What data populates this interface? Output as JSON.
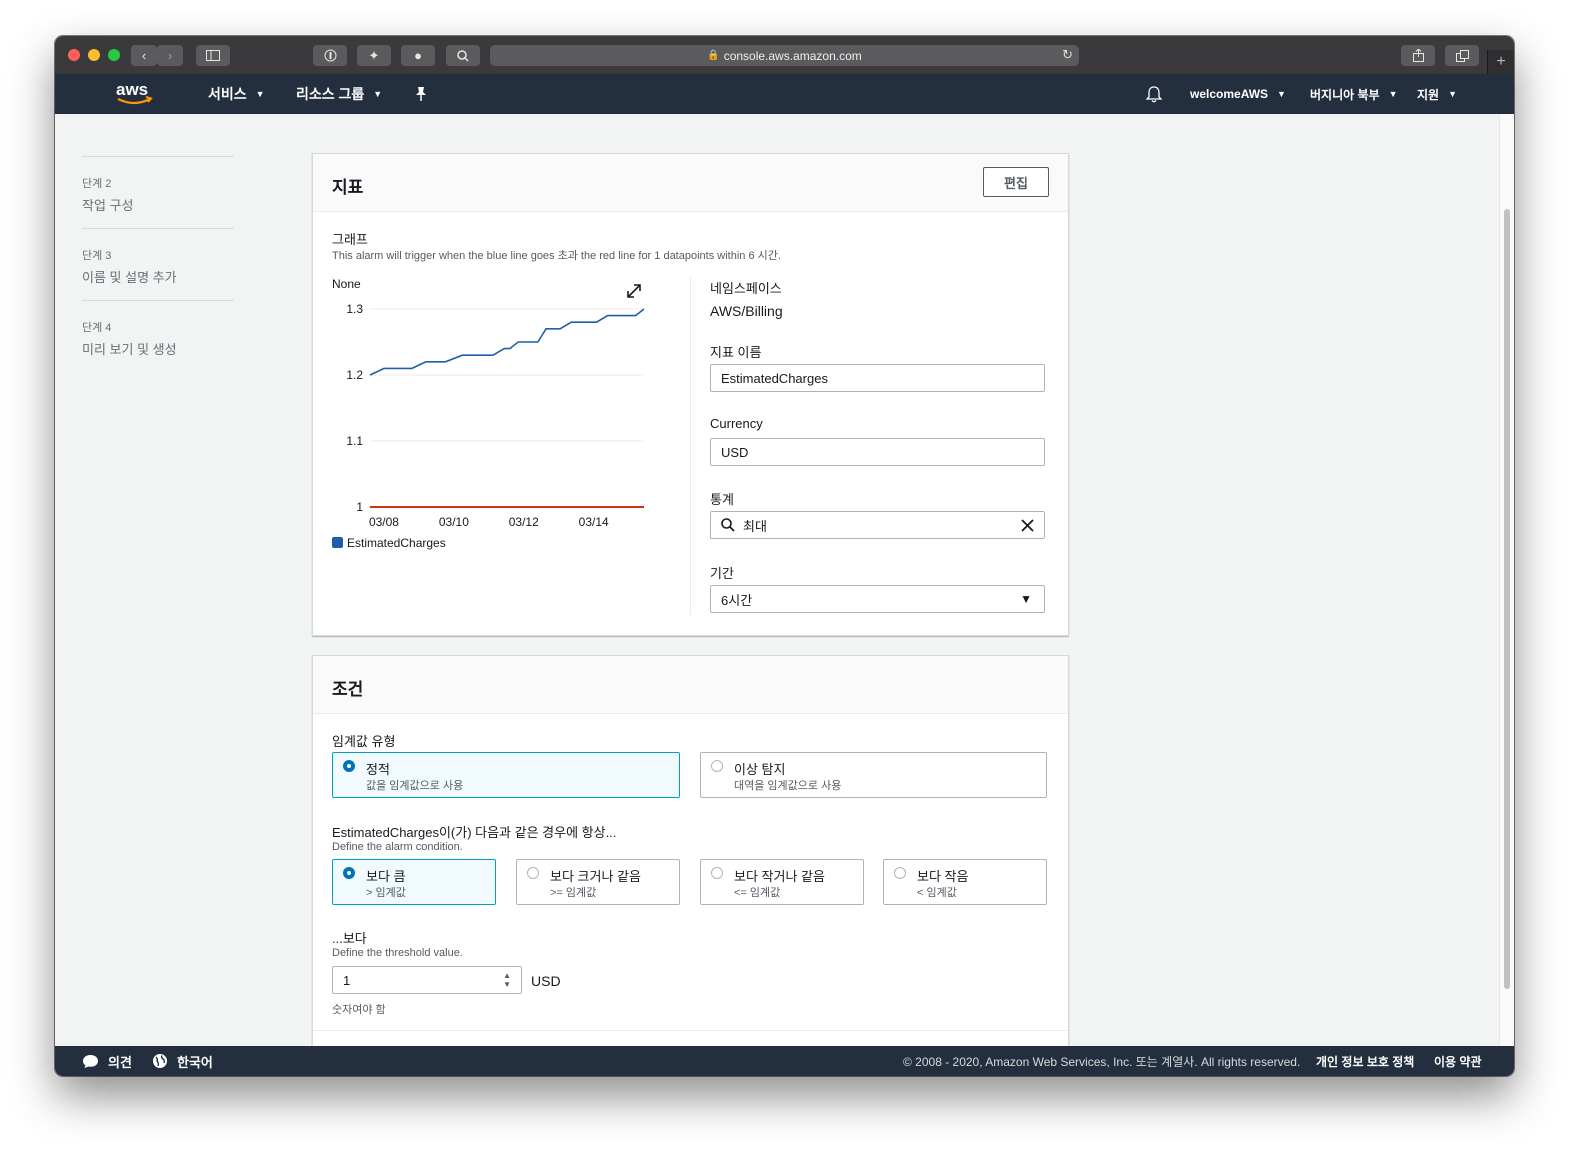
{
  "browser": {
    "url": "console.aws.amazon.com"
  },
  "nav": {
    "services": "서비스",
    "resource_groups": "리소스 그룹",
    "account": "welcomeAWS",
    "region": "버지니아 북부",
    "support": "지원"
  },
  "steps": [
    {
      "num": "단계 2",
      "label": "작업 구성"
    },
    {
      "num": "단계 3",
      "label": "이름 및 설명 추가"
    },
    {
      "num": "단계 4",
      "label": "미리 보기 및 생성"
    }
  ],
  "metric": {
    "title": "지표",
    "edit": "편집",
    "graph_label": "그래프",
    "graph_desc": "This alarm will trigger when the blue line goes 초과 the red line for 1 datapoints within 6 시간.",
    "unit_label": "None",
    "namespace_label": "네임스페이스",
    "namespace_value": "AWS/Billing",
    "metric_name_label": "지표 이름",
    "metric_name_value": "EstimatedCharges",
    "currency_label": "Currency",
    "currency_value": "USD",
    "statistic_label": "통계",
    "statistic_value": "최대",
    "period_label": "기간",
    "period_value": "6시간"
  },
  "chart_data": {
    "type": "line",
    "ylim": [
      1,
      1.3
    ],
    "yticks": [
      "1.3",
      "1.2",
      "1.1",
      "1"
    ],
    "xticks": [
      "03/08",
      "03/10",
      "03/12",
      "03/14"
    ],
    "legend": "EstimatedCharges",
    "series": [
      {
        "name": "EstimatedCharges",
        "color": "#1f5fa6",
        "x": [
          0,
          0.5,
          1,
          1.5,
          2,
          2.3,
          2.7,
          3.3,
          3.5,
          4,
          4.4,
          4.8,
          5,
          5.3,
          5.6,
          6,
          6.3,
          6.6,
          6.8,
          7.2,
          7.5,
          7.9,
          8.1,
          8.5,
          8.9,
          9.2,
          9.5,
          9.8
        ],
        "y": [
          1.2,
          1.21,
          1.21,
          1.21,
          1.22,
          1.22,
          1.22,
          1.23,
          1.23,
          1.23,
          1.23,
          1.24,
          1.24,
          1.25,
          1.25,
          1.25,
          1.27,
          1.27,
          1.27,
          1.28,
          1.28,
          1.28,
          1.28,
          1.29,
          1.29,
          1.29,
          1.29,
          1.3
        ]
      },
      {
        "name": "threshold",
        "color": "#d13212",
        "x": [
          0,
          9.8
        ],
        "y": [
          1,
          1
        ]
      }
    ],
    "xrange": [
      0,
      9.8
    ],
    "xtick_positions": [
      0.5,
      3.0,
      5.5,
      8.0
    ]
  },
  "conditions": {
    "title": "조건",
    "threshold_type_label": "임계값 유형",
    "static_title": "정적",
    "static_sub": "값을 임계값으로 사용",
    "anomaly_title": "이상 탐지",
    "anomaly_sub": "대역을 임계값으로 사용",
    "whenever_label": "EstimatedCharges이(가) 다음과 같은 경우에 항상...",
    "whenever_desc": "Define the alarm condition.",
    "options": [
      {
        "title": "보다 큼",
        "sub": "> 임계값",
        "selected": true
      },
      {
        "title": "보다 크거나 같음",
        "sub": ">= 임계값",
        "selected": false
      },
      {
        "title": "보다 작거나 같음",
        "sub": "<= 임계값",
        "selected": false
      },
      {
        "title": "보다 작음",
        "sub": "< 임계값",
        "selected": false
      }
    ],
    "than_label": "...보다",
    "than_desc": "Define the threshold value.",
    "threshold_value": "1",
    "threshold_unit": "USD",
    "hint": "숫자여야 함"
  },
  "footer": {
    "feedback": "의견",
    "language": "한국어",
    "copyright": "© 2008 - 2020, Amazon Web Services, Inc. 또는 계열사. All rights reserved.",
    "privacy": "개인 정보 보호 정책",
    "terms": "이용 약관"
  }
}
